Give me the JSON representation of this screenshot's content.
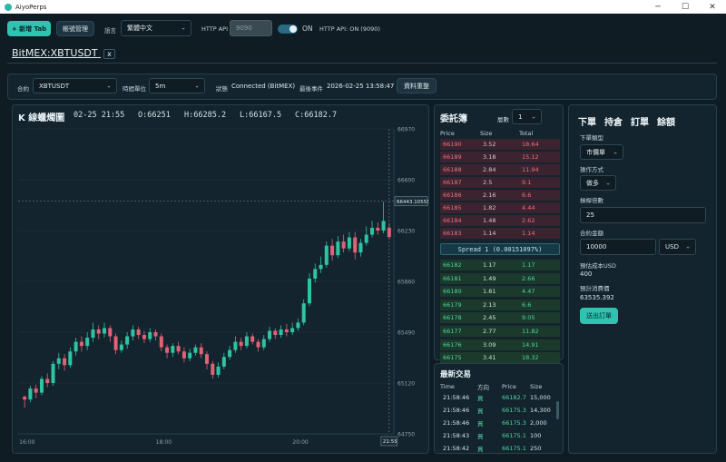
{
  "window": {
    "title": "AiyoPerps",
    "minimize": "─",
    "maximize": "☐",
    "close": "✕"
  },
  "toolbar": {
    "new_tab": "+ 新增 Tab",
    "account_mgmt": "帳號管理",
    "language_label": "語言",
    "language_value": "繁體中文",
    "http_api_label": "HTTP API",
    "http_api_port": "9090",
    "toggle_state": "ON",
    "http_api_status": "HTTP API: ON (9090)"
  },
  "tab": {
    "label": "BitMEX:XBTUSDT",
    "close": "x"
  },
  "controls": {
    "contract_label": "合約",
    "contract_value": "XBTUSDT",
    "timeframe_label": "時間單位",
    "timeframe_value": "5m",
    "status_label": "狀態",
    "status_value": "Connected (BitMEX)",
    "last_event_label": "最後事件",
    "last_event_value": "2026-02-25 13:58:47",
    "reload_button": "資料重整"
  },
  "chart_header": {
    "title": "K 線蠟燭圖",
    "time": "02-25 21:55",
    "open": "O:66251",
    "high": "H:66285.2",
    "low": "L:66167.5",
    "close": "C:66182.7"
  },
  "chart_data": {
    "type": "candlestick",
    "x_ticks": [
      "16:00",
      "18:00",
      "20:00"
    ],
    "crosshair_time": "21:55",
    "y_ticks": [
      "66970",
      "66600",
      "66230",
      "65860",
      "65490",
      "65120",
      "64750"
    ],
    "crosshair_price": "66443.10555",
    "ylim": [
      64750,
      66970
    ],
    "candles": [
      [
        65020,
        65000,
        64940,
        65030
      ],
      [
        65000,
        65080,
        64980,
        65100
      ],
      [
        65080,
        65050,
        65010,
        65110
      ],
      [
        65050,
        65150,
        65030,
        65170
      ],
      [
        65150,
        65120,
        65090,
        65190
      ],
      [
        65120,
        65260,
        65100,
        65280
      ],
      [
        65260,
        65300,
        65220,
        65340
      ],
      [
        65300,
        65250,
        65210,
        65330
      ],
      [
        65250,
        65350,
        65230,
        65380
      ],
      [
        65350,
        65420,
        65320,
        65450
      ],
      [
        65420,
        65390,
        65350,
        65460
      ],
      [
        65390,
        65450,
        65360,
        65490
      ],
      [
        65450,
        65510,
        65420,
        65560
      ],
      [
        65510,
        65480,
        65440,
        65540
      ],
      [
        65480,
        65520,
        65450,
        65560
      ],
      [
        65520,
        65460,
        65420,
        65540
      ],
      [
        65460,
        65360,
        65330,
        65480
      ],
      [
        65360,
        65400,
        65340,
        65430
      ],
      [
        65400,
        65460,
        65370,
        65490
      ],
      [
        65460,
        65510,
        65430,
        65540
      ],
      [
        65510,
        65470,
        65440,
        65530
      ],
      [
        65470,
        65440,
        65410,
        65500
      ],
      [
        65440,
        65490,
        65420,
        65520
      ],
      [
        65490,
        65460,
        65430,
        65510
      ],
      [
        65460,
        65380,
        65350,
        65480
      ],
      [
        65380,
        65340,
        65300,
        65400
      ],
      [
        65340,
        65390,
        65310,
        65410
      ],
      [
        65390,
        65350,
        65330,
        65420
      ],
      [
        65350,
        65300,
        65270,
        65380
      ],
      [
        65300,
        65340,
        65280,
        65370
      ],
      [
        65340,
        65380,
        65320,
        65400
      ],
      [
        65380,
        65330,
        65300,
        65410
      ],
      [
        65330,
        65260,
        65220,
        65350
      ],
      [
        65260,
        65180,
        65150,
        65280
      ],
      [
        65180,
        65240,
        65160,
        65270
      ],
      [
        65240,
        65310,
        65220,
        65340
      ],
      [
        65310,
        65360,
        65290,
        65390
      ],
      [
        65360,
        65420,
        65340,
        65460
      ],
      [
        65420,
        65390,
        65360,
        65450
      ],
      [
        65390,
        65460,
        65370,
        65490
      ],
      [
        65460,
        65420,
        65400,
        65480
      ],
      [
        65420,
        65380,
        65350,
        65440
      ],
      [
        65380,
        65440,
        65360,
        65470
      ],
      [
        65440,
        65500,
        65420,
        65530
      ],
      [
        65500,
        65470,
        65440,
        65520
      ],
      [
        65470,
        65510,
        65450,
        65540
      ],
      [
        65510,
        65490,
        65460,
        65550
      ],
      [
        65490,
        65520,
        65470,
        65560
      ],
      [
        65520,
        65560,
        65500,
        65590
      ],
      [
        65560,
        65700,
        65540,
        65730
      ],
      [
        65700,
        65880,
        65680,
        65920
      ],
      [
        65880,
        65950,
        65850,
        65990
      ],
      [
        65950,
        65980,
        65920,
        66040
      ],
      [
        65980,
        66120,
        65960,
        66150
      ],
      [
        66120,
        66050,
        66010,
        66170
      ],
      [
        66050,
        66150,
        66030,
        66190
      ],
      [
        66150,
        66100,
        66070,
        66200
      ],
      [
        66100,
        66180,
        66080,
        66220
      ],
      [
        66180,
        66070,
        66020,
        66220
      ],
      [
        66070,
        66140,
        66040,
        66170
      ],
      [
        66140,
        66200,
        66120,
        66260
      ],
      [
        66200,
        66250,
        66180,
        66300
      ],
      [
        66250,
        66230,
        66200,
        66290
      ],
      [
        66230,
        66300,
        66210,
        66440
      ],
      [
        66251,
        66182.7,
        66167.5,
        66285.2
      ]
    ]
  },
  "orderbook": {
    "title": "委託簿",
    "depth_label": "層數",
    "depth_value": "1",
    "headers": [
      "Price",
      "Size",
      "Total"
    ],
    "asks": [
      [
        "66190",
        "3.52",
        "18.64"
      ],
      [
        "66189",
        "3.18",
        "15.12"
      ],
      [
        "66188",
        "2.84",
        "11.94"
      ],
      [
        "66187",
        "2.5",
        "9.1"
      ],
      [
        "66186",
        "2.16",
        "6.6"
      ],
      [
        "66185",
        "1.82",
        "4.44"
      ],
      [
        "66184",
        "1.48",
        "2.62"
      ],
      [
        "66183",
        "1.14",
        "1.14"
      ]
    ],
    "spread": "Spread 1 (0.00151097%)",
    "bids": [
      [
        "66182",
        "1.17",
        "1.17"
      ],
      [
        "66181",
        "1.49",
        "2.66"
      ],
      [
        "66180",
        "1.81",
        "4.47"
      ],
      [
        "66179",
        "2.13",
        "6.6"
      ],
      [
        "66178",
        "2.45",
        "9.05"
      ],
      [
        "66177",
        "2.77",
        "11.82"
      ],
      [
        "66176",
        "3.09",
        "14.91"
      ],
      [
        "66175",
        "3.41",
        "18.32"
      ]
    ]
  },
  "trades": {
    "title": "最新交易",
    "headers": [
      "Time",
      "方向",
      "Price",
      "Size"
    ],
    "rows": [
      [
        "21:58:46",
        "買",
        "66182.7",
        "15,000"
      ],
      [
        "21:58:46",
        "買",
        "66175.3",
        "14,300"
      ],
      [
        "21:58:46",
        "買",
        "66175.3",
        "2,000"
      ],
      [
        "21:58:43",
        "買",
        "66175.1",
        "100"
      ],
      [
        "21:58:42",
        "買",
        "66175.1",
        "250"
      ]
    ]
  },
  "order_panel": {
    "tabs": [
      "下單",
      "持倉",
      "訂單",
      "餘額"
    ],
    "order_type_label": "下單類型",
    "order_type_value": "市價單",
    "side_label": "操作方式",
    "side_value": "做多",
    "leverage_label": "槓桿倍數",
    "leverage_value": "25",
    "amount_label": "合約金額",
    "amount_value": "10000",
    "currency_value": "USD",
    "est_cost_label": "預估成本USD",
    "est_cost_value": "400",
    "est_qty_label": "預計消費價",
    "est_qty_value": "63535.392",
    "submit_button": "送出訂單"
  },
  "colors": {
    "up": "#2fc3a0",
    "down": "#e06275",
    "accent": "#2fc3b0",
    "bg": "#0f1c24"
  }
}
